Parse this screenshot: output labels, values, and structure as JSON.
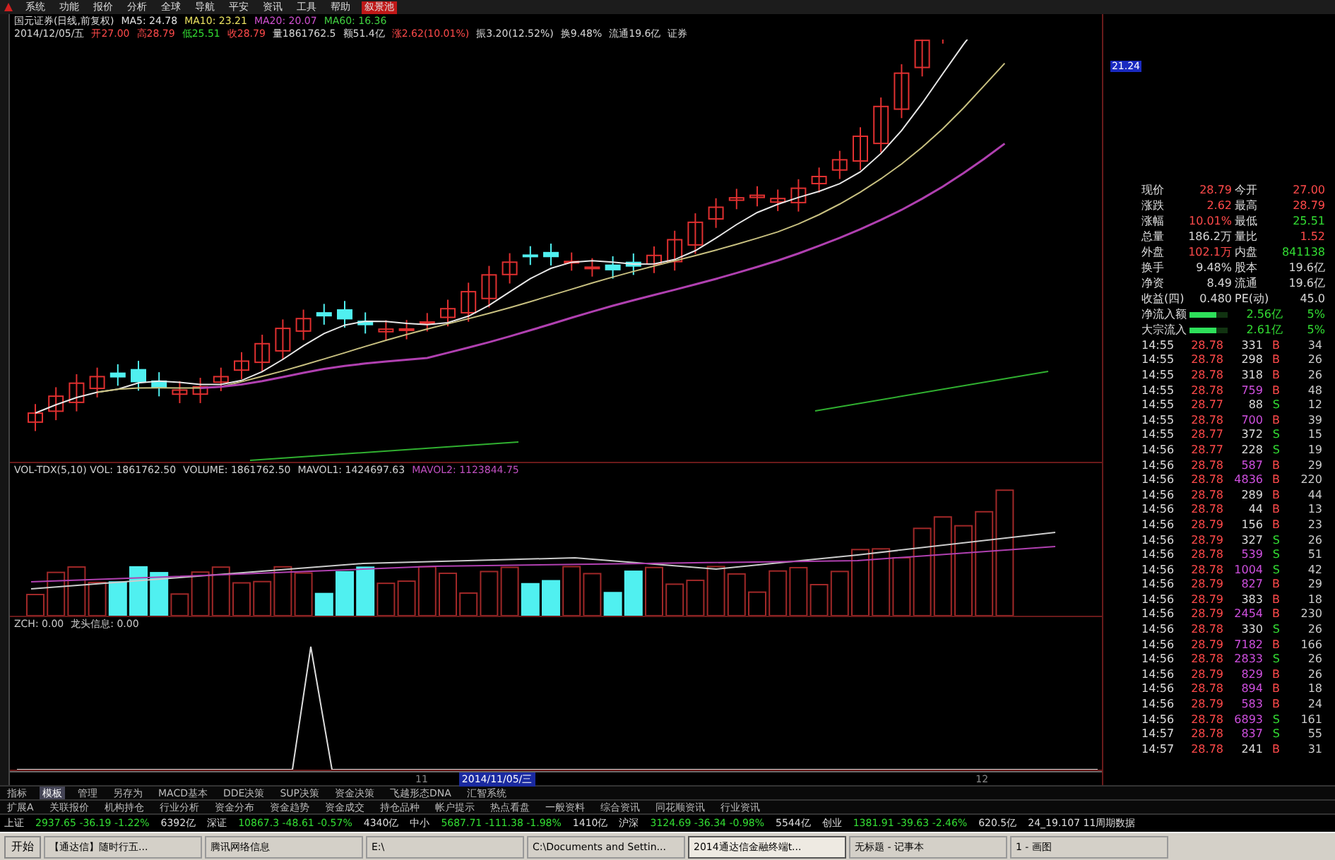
{
  "menu": [
    {
      "label": "系统",
      "selected": false
    },
    {
      "label": "功能",
      "selected": false
    },
    {
      "label": "报价",
      "selected": false
    },
    {
      "label": "分析",
      "selected": false
    },
    {
      "label": "全球",
      "selected": false
    },
    {
      "label": "导航",
      "selected": false
    },
    {
      "label": "平安",
      "selected": false
    },
    {
      "label": "资讯",
      "selected": false
    },
    {
      "label": "工具",
      "selected": false
    },
    {
      "label": "帮助",
      "selected": false
    },
    {
      "label": "叙景池",
      "selected": true
    }
  ],
  "legend": {
    "title": "国元证券(日线,前复权)",
    "ma": [
      {
        "text": "MA5: 24.78",
        "color": "#e0e0e0"
      },
      {
        "text": "MA10: 23.21",
        "color": "#e8e060"
      },
      {
        "text": "MA20: 20.07",
        "color": "#d050d0"
      },
      {
        "text": "MA60: 16.36",
        "color": "#40d040"
      }
    ],
    "info": [
      {
        "text": "2014/12/05/五",
        "color": "#d8d8d8"
      },
      {
        "text": "开27.00",
        "color": "#ff4a4a"
      },
      {
        "text": "高28.79",
        "color": "#ff4a4a"
      },
      {
        "text": "低25.51",
        "color": "#33dd33"
      },
      {
        "text": "收28.79",
        "color": "#ff4a4a"
      },
      {
        "text": "量1861762.5",
        "color": "#d8d8d8"
      },
      {
        "text": "额51.4亿",
        "color": "#d8d8d8"
      },
      {
        "text": "涨2.62(10.01%)",
        "color": "#ff4a4a"
      },
      {
        "text": "振3.20(12.52%)",
        "color": "#d8d8d8"
      },
      {
        "text": "换9.48%",
        "color": "#d8d8d8"
      },
      {
        "text": "流通19.6亿",
        "color": "#d8d8d8"
      },
      {
        "text": "证券",
        "color": "#d8d8d8"
      }
    ]
  },
  "volume_legend": [
    {
      "text": "VOL-TDX(5,10) VOL: 1861762.50",
      "color": "#d0d0d0"
    },
    {
      "text": "VOLUME: 1861762.50",
      "color": "#d0d0d0"
    },
    {
      "text": "MAVOL1: 1424697.63",
      "color": "#d0d0d0"
    },
    {
      "text": "MAVOL2: 1123844.75",
      "color": "#c050c0"
    }
  ],
  "indicator_legend": [
    {
      "text": "ZCH: 0.00"
    },
    {
      "text": "龙头信息: 0.00"
    }
  ],
  "date_axis": [
    {
      "label": "11",
      "selected": false
    },
    {
      "label": "2014/11/05/三",
      "selected": true
    },
    {
      "label": "12",
      "selected": false
    }
  ],
  "price_cursor": "21.24",
  "quote": [
    {
      "cells": [
        {
          "label": "现价",
          "value": "28.79",
          "color": "#ff4a4a"
        },
        {
          "label": "今开",
          "value": "27.00",
          "color": "#ff4a4a"
        }
      ]
    },
    {
      "cells": [
        {
          "label": "涨跌",
          "value": "2.62",
          "color": "#ff4a4a"
        },
        {
          "label": "最高",
          "value": "28.79",
          "color": "#ff4a4a"
        }
      ]
    },
    {
      "cells": [
        {
          "label": "涨幅",
          "value": "10.01%",
          "color": "#ff4a4a"
        },
        {
          "label": "最低",
          "value": "25.51",
          "color": "#33dd33"
        }
      ]
    },
    {
      "cells": [
        {
          "label": "总量",
          "value": "186.2万",
          "color": "#d8d8d8"
        },
        {
          "label": "量比",
          "value": "1.52",
          "color": "#ff4a4a"
        }
      ]
    },
    {
      "cells": [
        {
          "label": "外盘",
          "value": "102.1万",
          "color": "#ff4a4a"
        },
        {
          "label": "内盘",
          "value": "841138",
          "color": "#33dd33"
        }
      ]
    },
    {
      "cells": [
        {
          "label": "换手",
          "value": "9.48%",
          "color": "#d8d8d8"
        },
        {
          "label": "股本",
          "value": "19.6亿",
          "color": "#d8d8d8"
        }
      ]
    },
    {
      "cells": [
        {
          "label": "净资",
          "value": "8.49",
          "color": "#d8d8d8"
        },
        {
          "label": "流通",
          "value": "19.6亿",
          "color": "#d8d8d8"
        }
      ]
    },
    {
      "cells": [
        {
          "label": "收益(四)",
          "value": "0.480",
          "color": "#d8d8d8"
        },
        {
          "label": "PE(动)",
          "value": "45.0",
          "color": "#d8d8d8"
        }
      ]
    }
  ],
  "flows": [
    {
      "label": "净流入额",
      "level": 0.7,
      "amount": "2.56亿",
      "pct": "5%"
    },
    {
      "label": "大宗流入",
      "level": 0.7,
      "amount": "2.61亿",
      "pct": "5%"
    }
  ],
  "trades": [
    {
      "time": "14:55",
      "price": "28.78",
      "volume": "331",
      "big": false,
      "side": "B",
      "kind": "buy",
      "count": "34"
    },
    {
      "time": "14:55",
      "price": "28.78",
      "volume": "298",
      "big": false,
      "side": "B",
      "kind": "buy",
      "count": "26"
    },
    {
      "time": "14:55",
      "price": "28.78",
      "volume": "318",
      "big": false,
      "side": "B",
      "kind": "buy",
      "count": "26"
    },
    {
      "time": "14:55",
      "price": "28.78",
      "volume": "759",
      "big": true,
      "side": "B",
      "kind": "buy",
      "count": "48"
    },
    {
      "time": "14:55",
      "price": "28.77",
      "volume": "88",
      "big": false,
      "side": "S",
      "kind": "sell",
      "count": "12"
    },
    {
      "time": "14:55",
      "price": "28.78",
      "volume": "700",
      "big": true,
      "side": "B",
      "kind": "buy",
      "count": "39"
    },
    {
      "time": "14:55",
      "price": "28.77",
      "volume": "372",
      "big": false,
      "side": "S",
      "kind": "sell",
      "count": "15"
    },
    {
      "time": "14:56",
      "price": "28.77",
      "volume": "228",
      "big": false,
      "side": "S",
      "kind": "sell",
      "count": "19"
    },
    {
      "time": "14:56",
      "price": "28.78",
      "volume": "587",
      "big": true,
      "side": "B",
      "kind": "buy",
      "count": "29"
    },
    {
      "time": "14:56",
      "price": "28.78",
      "volume": "4836",
      "big": true,
      "side": "B",
      "kind": "buy",
      "count": "220"
    },
    {
      "time": "14:56",
      "price": "28.78",
      "volume": "289",
      "big": false,
      "side": "B",
      "kind": "buy",
      "count": "44"
    },
    {
      "time": "14:56",
      "price": "28.78",
      "volume": "44",
      "big": false,
      "side": "B",
      "kind": "buy",
      "count": "13"
    },
    {
      "time": "14:56",
      "price": "28.79",
      "volume": "156",
      "big": false,
      "side": "B",
      "kind": "buy",
      "count": "23"
    },
    {
      "time": "14:56",
      "price": "28.79",
      "volume": "327",
      "big": false,
      "side": "S",
      "kind": "sell",
      "count": "26"
    },
    {
      "time": "14:56",
      "price": "28.78",
      "volume": "539",
      "big": true,
      "side": "S",
      "kind": "sell",
      "count": "51"
    },
    {
      "time": "14:56",
      "price": "28.78",
      "volume": "1004",
      "big": true,
      "side": "S",
      "kind": "sell",
      "count": "42"
    },
    {
      "time": "14:56",
      "price": "28.79",
      "volume": "827",
      "big": true,
      "side": "B",
      "kind": "buy",
      "count": "29"
    },
    {
      "time": "14:56",
      "price": "28.79",
      "volume": "383",
      "big": false,
      "side": "B",
      "kind": "buy",
      "count": "18"
    },
    {
      "time": "14:56",
      "price": "28.79",
      "volume": "2454",
      "big": true,
      "side": "B",
      "kind": "buy",
      "count": "230"
    },
    {
      "time": "14:56",
      "price": "28.78",
      "volume": "330",
      "big": false,
      "side": "S",
      "kind": "sell",
      "count": "26"
    },
    {
      "time": "14:56",
      "price": "28.79",
      "volume": "7182",
      "big": true,
      "side": "B",
      "kind": "buy",
      "count": "166"
    },
    {
      "time": "14:56",
      "price": "28.78",
      "volume": "2833",
      "big": true,
      "side": "S",
      "kind": "sell",
      "count": "26"
    },
    {
      "time": "14:56",
      "price": "28.79",
      "volume": "829",
      "big": true,
      "side": "B",
      "kind": "buy",
      "count": "26"
    },
    {
      "time": "14:56",
      "price": "28.78",
      "volume": "894",
      "big": true,
      "side": "B",
      "kind": "buy",
      "count": "18"
    },
    {
      "time": "14:56",
      "price": "28.79",
      "volume": "583",
      "big": true,
      "side": "B",
      "kind": "buy",
      "count": "24"
    },
    {
      "time": "14:56",
      "price": "28.78",
      "volume": "6893",
      "big": true,
      "side": "S",
      "kind": "sell",
      "count": "161"
    },
    {
      "time": "14:57",
      "price": "28.78",
      "volume": "837",
      "big": true,
      "side": "S",
      "kind": "sell",
      "count": "55"
    },
    {
      "time": "14:57",
      "price": "28.78",
      "volume": "241",
      "big": false,
      "side": "B",
      "kind": "buy",
      "count": "31"
    }
  ],
  "indicator_tabs": [
    {
      "label": "指标",
      "selected": false
    },
    {
      "label": "模板",
      "selected": true
    },
    {
      "label": "管理",
      "selected": false
    },
    {
      "label": "另存为",
      "selected": false
    },
    {
      "label": "MACD基本",
      "selected": false
    },
    {
      "label": "DDE决策",
      "selected": false
    },
    {
      "label": "SUP决策",
      "selected": false
    },
    {
      "label": "资金决策",
      "selected": false
    },
    {
      "label": "飞越形态DNA",
      "selected": false
    },
    {
      "label": "汇智系统",
      "selected": false
    }
  ],
  "extension_tabs": [
    "扩展A",
    "关联报价",
    "机构持仓",
    "行业分析",
    "资金分布",
    "资金趋势",
    "资金成交",
    "持仓品种",
    "帐户提示",
    "热点看盘",
    "一般资料",
    "综合资讯",
    "同花顺资讯",
    "行业资讯"
  ],
  "status_bar": [
    {
      "name": "上证",
      "value": "2937.65",
      "change": "-36.19",
      "pct": "-1.22%",
      "amount": "6392亿",
      "color": "#33dd33"
    },
    {
      "name": "深证",
      "value": "10867.3",
      "change": "-48.61",
      "pct": "-0.57%",
      "amount": "4340亿",
      "color": "#33dd33"
    },
    {
      "name": "中小",
      "value": "5687.71",
      "change": "-111.38",
      "pct": "-1.98%",
      "amount": "1410亿",
      "color": "#33dd33"
    },
    {
      "name": "沪深",
      "value": "3124.69",
      "change": "-36.34",
      "pct": "-0.98%",
      "amount": "5544亿",
      "color": "#33dd33"
    },
    {
      "name": "创业",
      "value": "1381.91",
      "change": "-39.63",
      "pct": "-2.46%",
      "amount": "620.5亿",
      "color": "#33dd33"
    }
  ],
  "status_note": "24_19.107 11周期数据",
  "taskbar": {
    "start": "开始",
    "windows": [
      {
        "title": "【通达信】随时行五...",
        "selected": false
      },
      {
        "title": "腾讯网络信息",
        "selected": false
      },
      {
        "title": "E:\\",
        "selected": false
      },
      {
        "title": "C:\\Documents and Settin...",
        "selected": false
      },
      {
        "title": "2014通达信金融终端t...",
        "selected": true
      },
      {
        "title": "无标题 - 记事本",
        "selected": false
      },
      {
        "title": "1 - 画图",
        "selected": false
      }
    ]
  }
}
